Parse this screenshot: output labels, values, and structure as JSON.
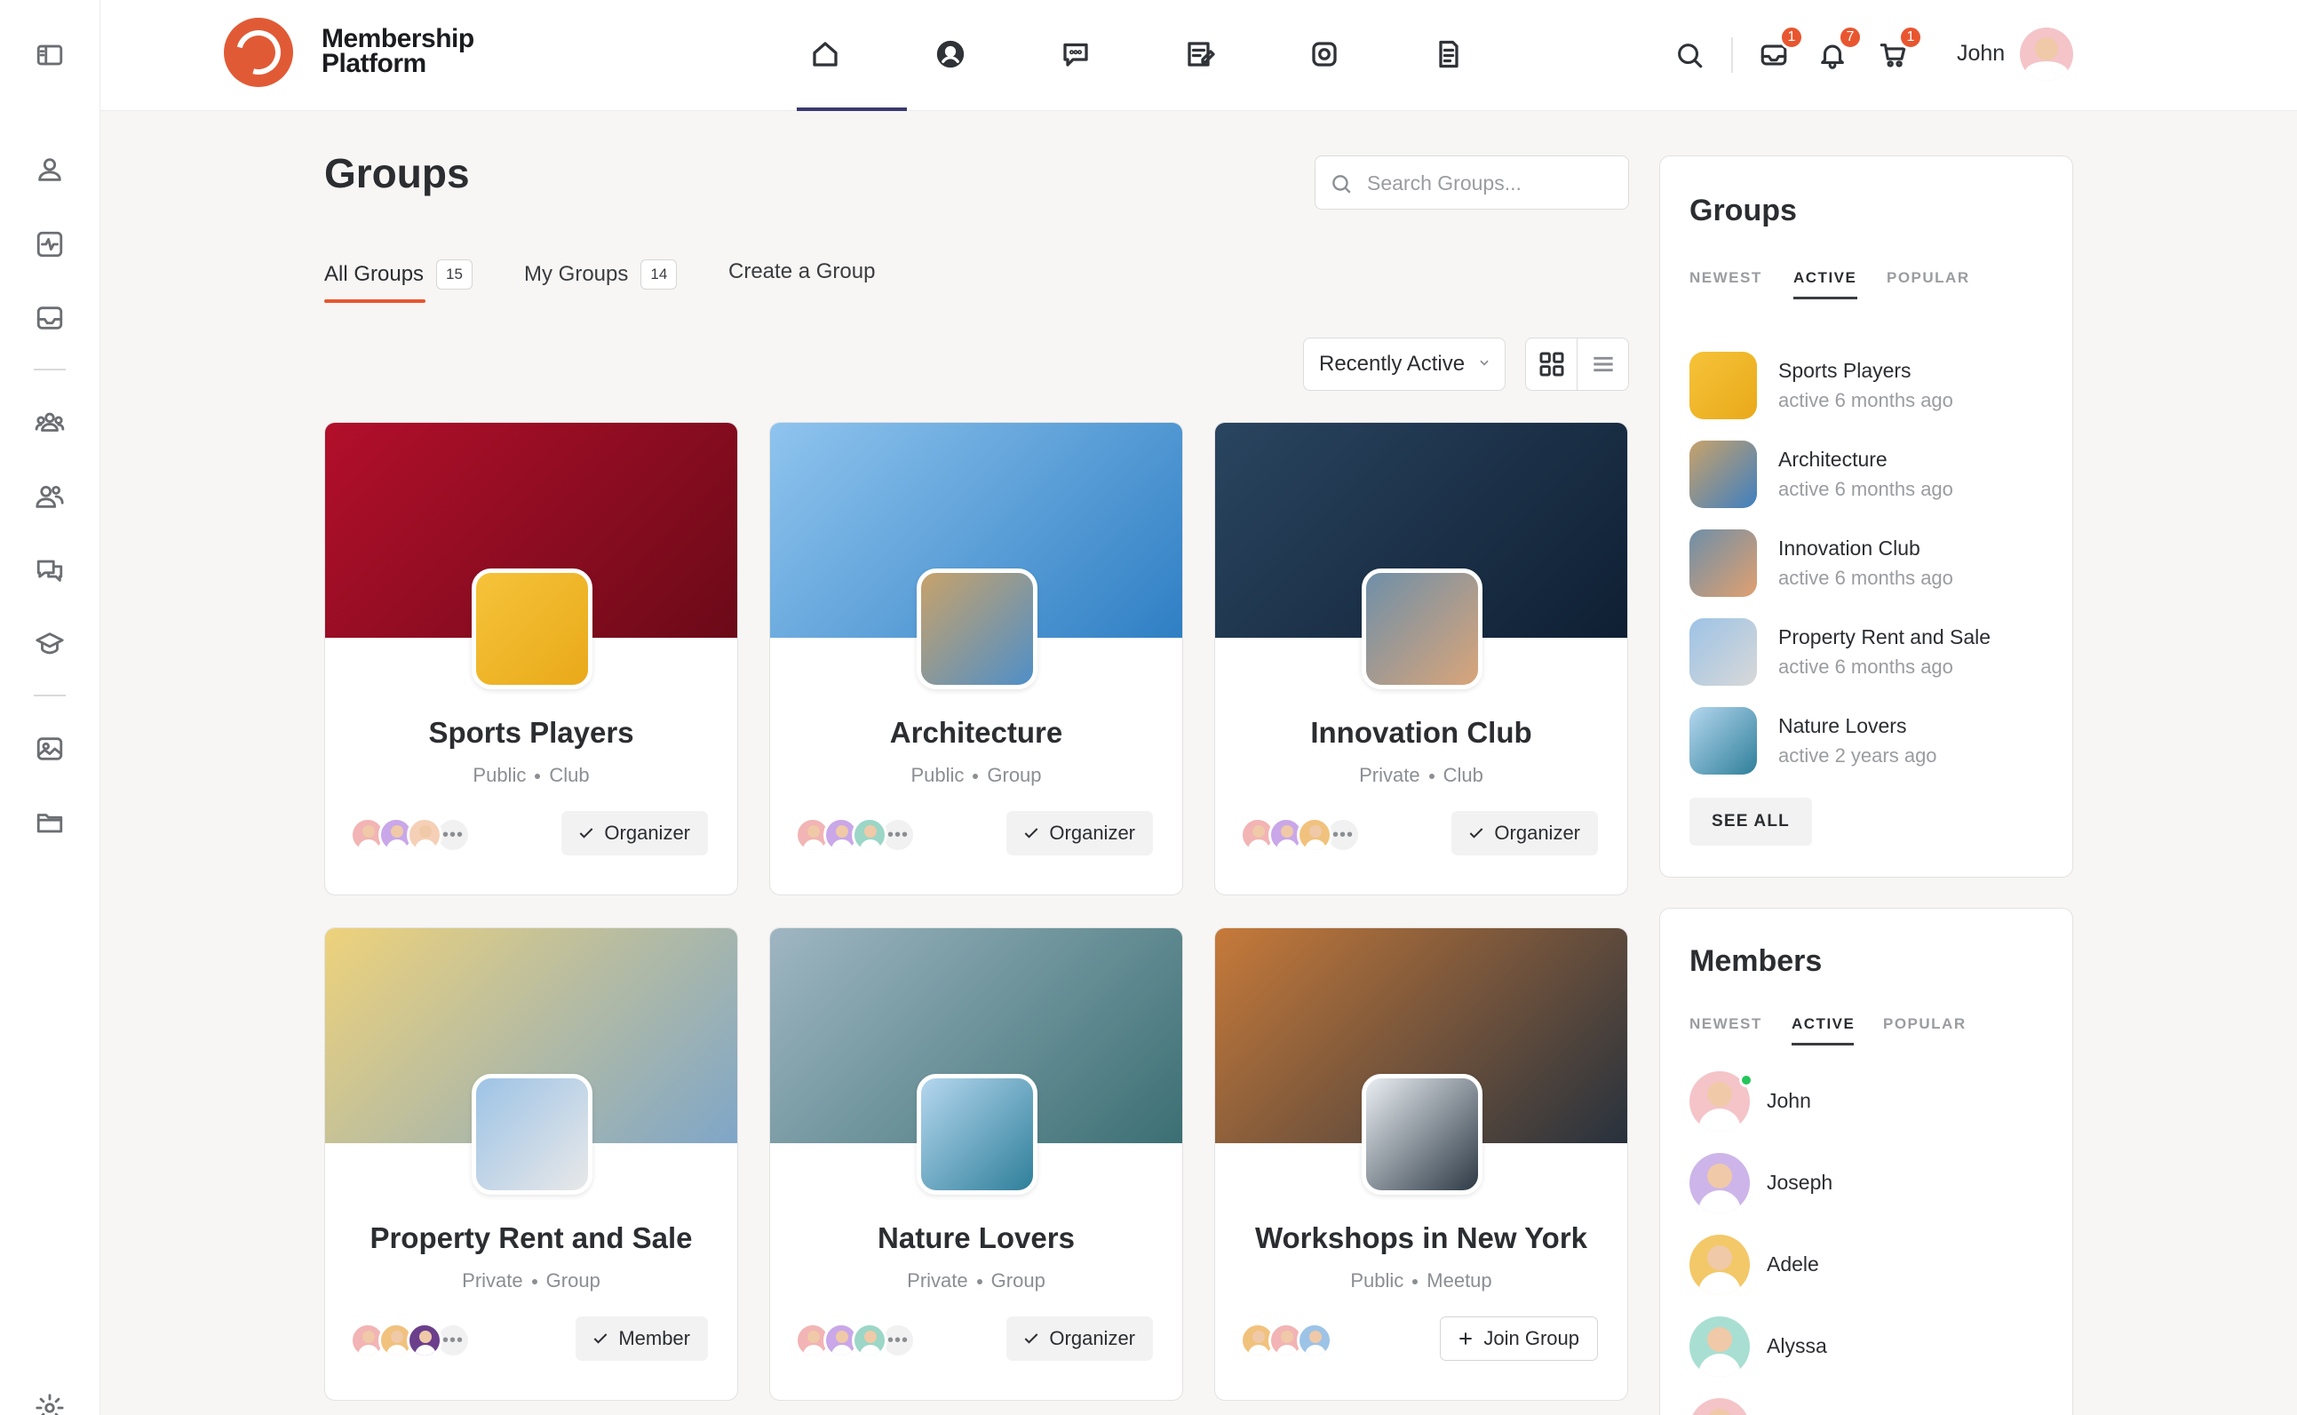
{
  "brand": {
    "line1": "Membership",
    "line2": "Platform"
  },
  "header": {
    "nav_icons": [
      "home-icon",
      "profile-icon",
      "messages-icon",
      "forums-icon",
      "photos-icon",
      "documents-icon"
    ],
    "badges": {
      "messages": "1",
      "notifications": "7",
      "cart": "1"
    },
    "user_name": "John"
  },
  "rail": {
    "icons": [
      "panel-toggle-icon",
      "user-icon",
      "activity-icon",
      "inbox-icon",
      "groups-icon",
      "members-icon",
      "forums-icon",
      "courses-icon",
      "photos-icon",
      "folder-icon",
      "settings-icon"
    ]
  },
  "main": {
    "title": "Groups",
    "search_placeholder": "Search Groups...",
    "tabs": [
      {
        "label": "All Groups",
        "count": "15"
      },
      {
        "label": "My Groups",
        "count": "14"
      },
      {
        "label": "Create a Group"
      }
    ],
    "sort_label": "Recently Active"
  },
  "groups": [
    {
      "name": "Sports Players",
      "privacy": "Public",
      "type": "Club",
      "button": "Organizer",
      "cover": [
        "#b30f2b",
        "#6b0a18"
      ],
      "avatar": [
        "#f6c33a",
        "#e9a91a"
      ],
      "members": [
        "#f2b4b4",
        "#c9a7e8",
        "#f5d0b6"
      ],
      "more": true
    },
    {
      "name": "Architecture",
      "privacy": "Public",
      "type": "Group",
      "button": "Organizer",
      "cover": [
        "#8fc4ee",
        "#2f7fc4"
      ],
      "avatar": [
        "#c8a26a",
        "#4f8fc8"
      ],
      "members": [
        "#f2b4b4",
        "#c9a7e8",
        "#9bd6c6"
      ],
      "more": true
    },
    {
      "name": "Innovation Club",
      "privacy": "Private",
      "type": "Club",
      "button": "Organizer",
      "cover": [
        "#2a4560",
        "#0f1f33"
      ],
      "avatar": [
        "#6f8fa8",
        "#d9a57a"
      ],
      "members": [
        "#f2b4b4",
        "#c9a7e8",
        "#f1c27d"
      ],
      "more": true
    },
    {
      "name": "Property Rent and Sale",
      "privacy": "Private",
      "type": "Group",
      "button": "Member",
      "cover": [
        "#eed27b",
        "#7fa6c8"
      ],
      "avatar": [
        "#9dc3e6",
        "#e8e8e8"
      ],
      "members": [
        "#f2b4b4",
        "#f1c27d",
        "#6b3f8c"
      ],
      "more": true
    },
    {
      "name": "Nature Lovers",
      "privacy": "Private",
      "type": "Group",
      "button": "Organizer",
      "cover": [
        "#9fb6c2",
        "#3b6f73"
      ],
      "avatar": [
        "#b5d7ef",
        "#2f7f9a"
      ],
      "members": [
        "#f2b4b4",
        "#c9a7e8",
        "#9bd6c6"
      ],
      "more": true
    },
    {
      "name": "Workshops in New York",
      "privacy": "Public",
      "type": "Meetup",
      "button": "Join Group",
      "cover": [
        "#c77a3a",
        "#27313d"
      ],
      "avatar": [
        "#e9eef2",
        "#2e3a46"
      ],
      "members": [
        "#f1c27d",
        "#f2b4b4",
        "#9dc3e6"
      ],
      "more": false
    }
  ],
  "groups_widget": {
    "title": "Groups",
    "tabs": [
      "NEWEST",
      "ACTIVE",
      "POPULAR"
    ],
    "items": [
      {
        "name": "Sports Players",
        "activity": "active 6 months ago",
        "thumb": [
          "#f6c33a",
          "#e9a91a"
        ]
      },
      {
        "name": "Architecture",
        "activity": "active 6 months ago",
        "thumb": [
          "#c8a26a",
          "#3f7fc0"
        ]
      },
      {
        "name": "Innovation Club",
        "activity": "active 6 months ago",
        "thumb": [
          "#6f8fa8",
          "#e0a070"
        ]
      },
      {
        "name": "Property Rent and Sale",
        "activity": "active 6 months ago",
        "thumb": [
          "#9dc3e6",
          "#d8d8d8"
        ]
      },
      {
        "name": "Nature Lovers",
        "activity": "active 2 years ago",
        "thumb": [
          "#b5d7ef",
          "#2f7f9a"
        ]
      }
    ],
    "see_all": "SEE ALL"
  },
  "members_widget": {
    "title": "Members",
    "tabs": [
      "NEWEST",
      "ACTIVE",
      "POPULAR"
    ],
    "items": [
      {
        "name": "John",
        "bg": "#f4c4c8",
        "online": true
      },
      {
        "name": "Joseph",
        "bg": "#cdb5ea",
        "online": false
      },
      {
        "name": "Adele",
        "bg": "#f3c869",
        "online": false
      },
      {
        "name": "Alyssa",
        "bg": "#a9dfd2",
        "online": false
      },
      {
        "name": "",
        "bg": "#f4c4c8",
        "online": false
      }
    ]
  },
  "colors": {
    "accent": "#e8562f",
    "active_nav": "#3a3a6e",
    "online": "#24c65a"
  }
}
